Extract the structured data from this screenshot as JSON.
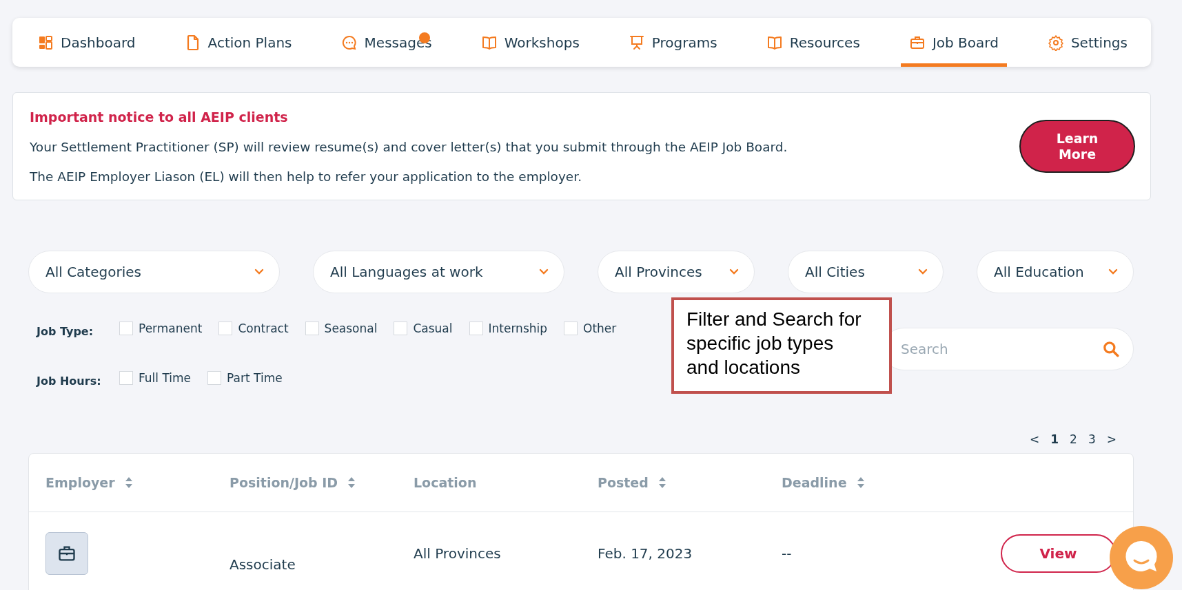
{
  "nav": {
    "tabs": [
      {
        "label": "Dashboard",
        "selected": false,
        "badge": false
      },
      {
        "label": "Action Plans",
        "selected": false,
        "badge": false
      },
      {
        "label": "Messages",
        "selected": false,
        "badge": true
      },
      {
        "label": "Workshops",
        "selected": false,
        "badge": false
      },
      {
        "label": "Programs",
        "selected": false,
        "badge": false
      },
      {
        "label": "Resources",
        "selected": false,
        "badge": false
      },
      {
        "label": "Job Board",
        "selected": true,
        "badge": false
      },
      {
        "label": "Settings",
        "selected": false,
        "badge": false
      }
    ]
  },
  "notice": {
    "title": "Important notice to all AEIP clients",
    "lines": [
      "Your Settlement Practitioner (SP) will review resume(s) and cover letter(s) that you submit through the AEIP Job Board.",
      "The AEIP Employer Liason (EL) will then help to refer your application to the employer."
    ],
    "button": "Learn More"
  },
  "filters": {
    "dropdowns": [
      "All Categories",
      "All Languages at work",
      "All Provinces",
      "All Cities",
      "All Education"
    ],
    "job_type": {
      "label": "Job Type:",
      "options": [
        {
          "label": "Permanent",
          "checked": false
        },
        {
          "label": "Contract",
          "checked": false
        },
        {
          "label": "Seasonal",
          "checked": false
        },
        {
          "label": "Casual",
          "checked": false
        },
        {
          "label": "Internship",
          "checked": false
        },
        {
          "label": "Other",
          "checked": false
        }
      ]
    },
    "job_hours": {
      "label": "Job Hours:",
      "options": [
        {
          "label": "Full Time",
          "checked": false
        },
        {
          "label": "Part Time",
          "checked": false
        }
      ]
    },
    "search": {
      "placeholder": "Search"
    }
  },
  "annotation": {
    "text": "Filter and Search for specific job types and locations"
  },
  "pagination": {
    "prev": "<",
    "pages": [
      {
        "label": "1",
        "selected": true
      },
      {
        "label": "2",
        "selected": false
      },
      {
        "label": "3",
        "selected": false
      }
    ],
    "next": ">"
  },
  "table": {
    "columns": [
      {
        "label": "Employer",
        "sortable": true
      },
      {
        "label": "Position/Job ID",
        "sortable": true
      },
      {
        "label": "Location",
        "sortable": false
      },
      {
        "label": "Posted",
        "sortable": true
      },
      {
        "label": "Deadline",
        "sortable": true
      }
    ],
    "rows": [
      {
        "position": "Associate",
        "location": "All Provinces",
        "posted": "Feb. 17, 2023",
        "deadline": "--",
        "action": "View"
      }
    ]
  }
}
